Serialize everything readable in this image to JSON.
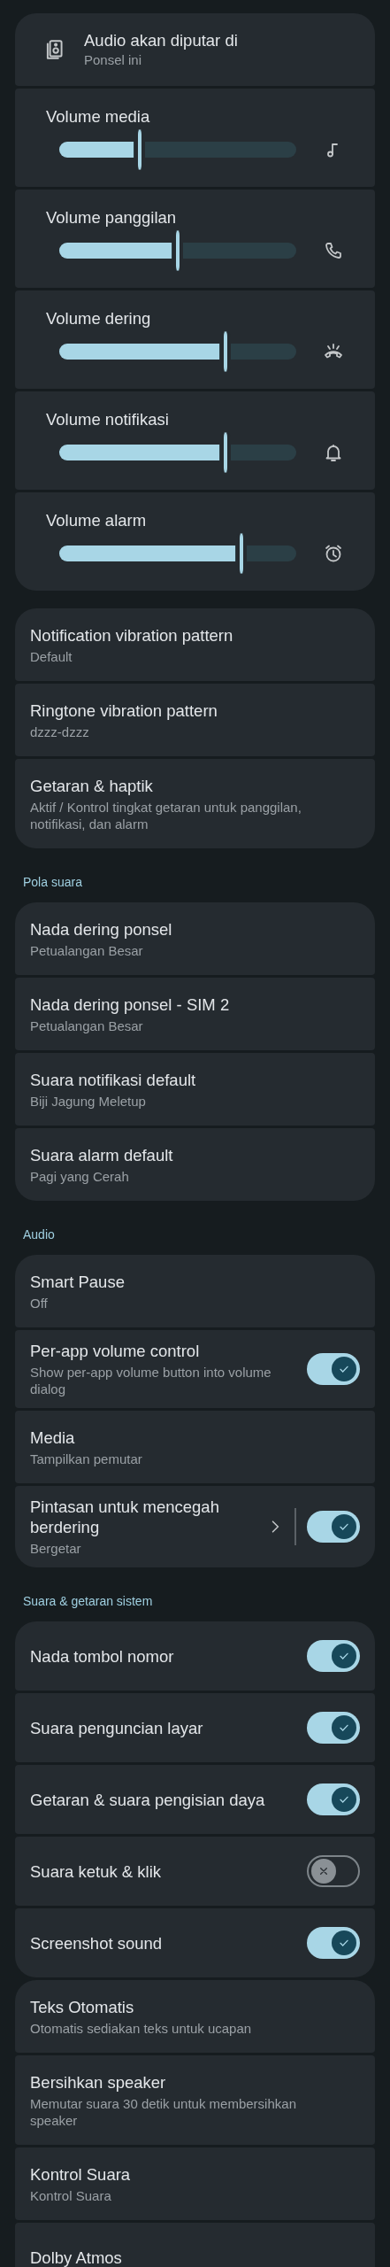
{
  "output_card": {
    "title": "Audio akan diputar di",
    "subtitle": "Ponsel ini"
  },
  "volumes": [
    {
      "label": "Volume media",
      "level": 0.34
    },
    {
      "label": "Volume panggilan",
      "level": 0.5
    },
    {
      "label": "Volume dering",
      "level": 0.7
    },
    {
      "label": "Volume notifikasi",
      "level": 0.7
    },
    {
      "label": "Volume alarm",
      "level": 0.77
    }
  ],
  "sections": [
    {
      "items": [
        {
          "kind": "text",
          "title": "Notification vibration pattern",
          "subtitle": "Default"
        },
        {
          "kind": "text",
          "title": "Ringtone vibration pattern",
          "subtitle": "dzzz-dzzz"
        },
        {
          "kind": "text",
          "title": "Getaran & haptik",
          "subtitle": "Aktif / Kontrol tingkat getaran untuk panggilan, notifikasi, dan alarm"
        }
      ]
    },
    {
      "header": "Pola suara",
      "items": [
        {
          "kind": "text",
          "title": "Nada dering ponsel",
          "subtitle": "Petualangan Besar"
        },
        {
          "kind": "text",
          "title": "Nada dering ponsel - SIM 2",
          "subtitle": "Petualangan Besar"
        },
        {
          "kind": "text",
          "title": "Suara notifikasi default",
          "subtitle": "Biji Jagung Meletup"
        },
        {
          "kind": "text",
          "title": "Suara alarm default",
          "subtitle": "Pagi yang Cerah"
        }
      ]
    },
    {
      "header": "Audio",
      "items": [
        {
          "kind": "text",
          "title": "Smart Pause",
          "subtitle": "Off"
        },
        {
          "kind": "toggle",
          "title": "Per-app volume control",
          "subtitle": "Show per-app volume button into volume dialog",
          "on": true
        },
        {
          "kind": "text",
          "title": "Media",
          "subtitle": "Tampilkan pemutar"
        },
        {
          "kind": "link_toggle",
          "title": "Pintasan untuk mencegah berdering",
          "subtitle": "Bergetar",
          "on": true
        }
      ]
    },
    {
      "header": "Suara & getaran sistem",
      "items": [
        {
          "kind": "toggle",
          "title": "Nada tombol nomor",
          "on": true
        },
        {
          "kind": "toggle",
          "title": "Suara penguncian layar",
          "on": true
        },
        {
          "kind": "toggle",
          "title": "Getaran & suara pengisian daya",
          "on": true
        },
        {
          "kind": "toggle",
          "title": "Suara ketuk & klik",
          "on": false
        },
        {
          "kind": "toggle",
          "title": "Screenshot sound",
          "on": true
        }
      ]
    },
    {
      "items": [
        {
          "kind": "text",
          "title": "Teks Otomatis",
          "subtitle": "Otomatis sediakan teks untuk ucapan"
        },
        {
          "kind": "text",
          "title": "Bersihkan speaker",
          "subtitle": "Memutar suara 30 detik untuk membersihkan speaker"
        },
        {
          "kind": "text",
          "title": "Kontrol Suara",
          "subtitle": "Kontrol Suara"
        },
        {
          "kind": "text",
          "title": "Dolby Atmos"
        }
      ]
    }
  ]
}
